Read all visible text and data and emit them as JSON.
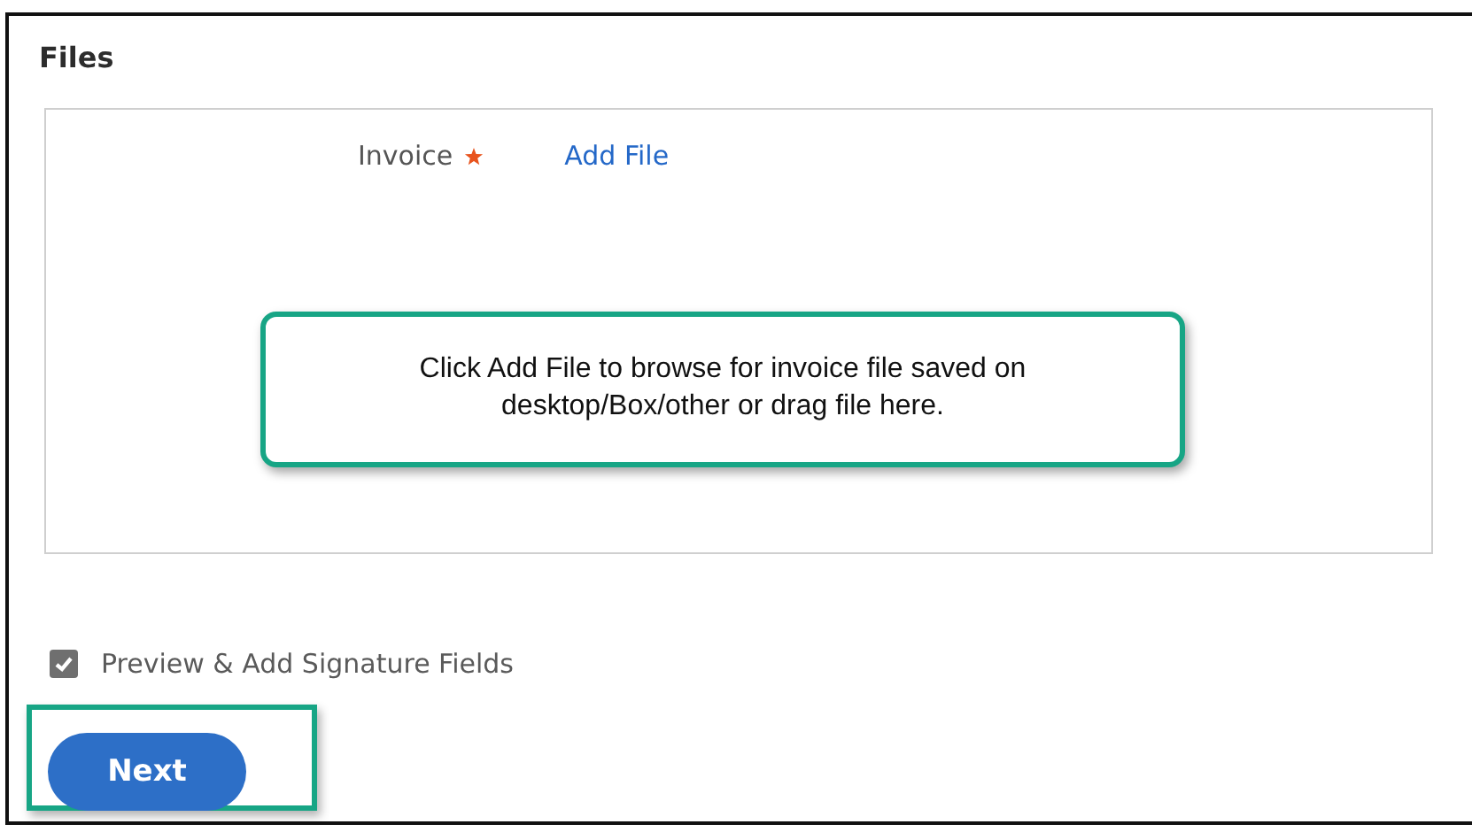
{
  "section": {
    "title": "Files"
  },
  "file_field": {
    "label": "Invoice",
    "required": true,
    "action": "Add File"
  },
  "callout": {
    "text": "Click Add File to browse for invoice file saved on desktop/Box/other or drag file here."
  },
  "preview_option": {
    "label": "Preview & Add Signature Fields",
    "checked": true
  },
  "next_button": {
    "label": "Next",
    "highlighted": true
  }
}
